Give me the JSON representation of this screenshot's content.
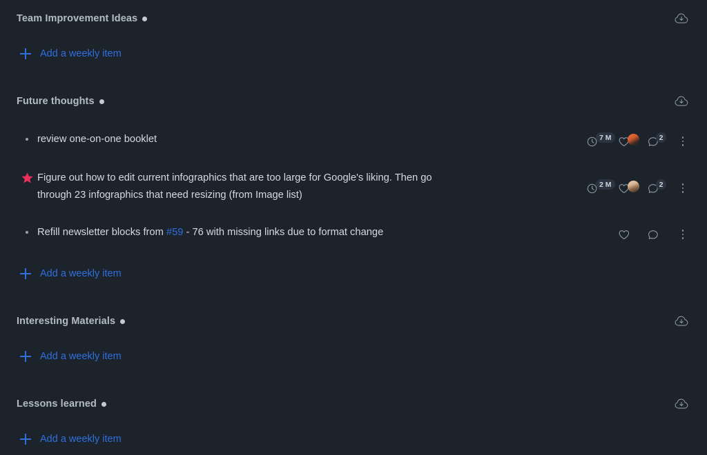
{
  "theme": {
    "background": "#1c232b",
    "section_title_color": "#b3bcc6",
    "body_text_color": "#d4dae0",
    "link_color": "#2f6fe0",
    "star_color": "#e8305a",
    "badge_bg": "#2b3440",
    "icon_stroke": "#8b96a3"
  },
  "add_item_label": "Add a weekly item",
  "icons": {
    "cloud_download": "cloud-download-icon",
    "plus": "plus-icon",
    "clock": "clock-icon",
    "heart": "heart-icon",
    "comment": "comment-icon",
    "menu": "more-options-icon",
    "star": "star-icon",
    "avatar": "avatar-icon"
  },
  "sections": [
    {
      "id": "team-improvement-ideas",
      "title": "Team Improvement Ideas",
      "has_dot": true,
      "has_cloud_download": true,
      "items": []
    },
    {
      "id": "future-thoughts",
      "title": "Future thoughts",
      "has_dot": true,
      "has_cloud_download": true,
      "items": [
        {
          "id": "item-review-booklet",
          "bullet": "dot",
          "text": "review one-on-one booklet",
          "time_badge": "7 M",
          "has_time": true,
          "has_avatar": true,
          "avatar_style": "a",
          "comment_count": "2",
          "has_comment_count": true
        },
        {
          "id": "item-infographics",
          "bullet": "star",
          "text": "Figure out how to edit current infographics that are too large for Google's liking. Then go through 23 infographics that need resizing (from Image list)",
          "time_badge": "2 M",
          "has_time": true,
          "has_avatar": true,
          "avatar_style": "b",
          "comment_count": "2",
          "has_comment_count": true
        },
        {
          "id": "item-refill-newsletter",
          "bullet": "dot",
          "text_before_link": "Refill newsletter blocks from ",
          "link_text": "#59",
          "text_after_link": " - 76 with missing links due to format change",
          "has_time": false,
          "has_avatar": false,
          "has_comment_count": false
        }
      ]
    },
    {
      "id": "interesting-materials",
      "title": "Interesting Materials",
      "has_dot": true,
      "has_cloud_download": true,
      "items": []
    },
    {
      "id": "lessons-learned",
      "title": "Lessons learned",
      "has_dot": true,
      "has_cloud_download": true,
      "items": []
    }
  ]
}
